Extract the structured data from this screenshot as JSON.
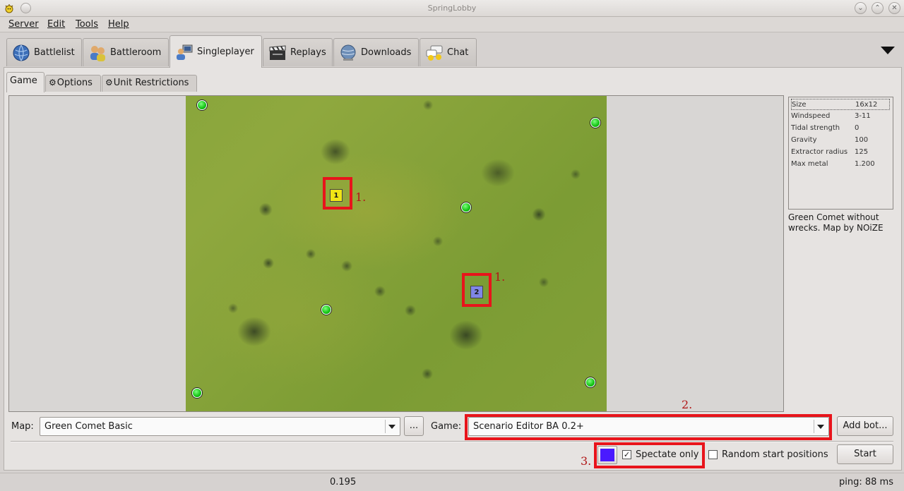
{
  "window": {
    "title": "SpringLobby"
  },
  "menubar": [
    {
      "label": "Server"
    },
    {
      "label": "Edit"
    },
    {
      "label": "Tools"
    },
    {
      "label": "Help"
    }
  ],
  "main_tabs": [
    {
      "label": "Battlelist",
      "icon": "globe-icon"
    },
    {
      "label": "Battleroom",
      "icon": "users-icon"
    },
    {
      "label": "Singleplayer",
      "icon": "user-computer-icon",
      "active": true
    },
    {
      "label": "Replays",
      "icon": "clapperboard-icon"
    },
    {
      "label": "Downloads",
      "icon": "globe-download-icon"
    },
    {
      "label": "Chat",
      "icon": "chat-icon"
    }
  ],
  "sub_tabs": [
    {
      "label": "Game",
      "active": true
    },
    {
      "label": "Options"
    },
    {
      "label": "Unit Restrictions"
    }
  ],
  "map_info": {
    "rows": [
      {
        "key": "Size",
        "value": "16x12"
      },
      {
        "key": "Windspeed",
        "value": "3-11"
      },
      {
        "key": "Tidal strength",
        "value": "0"
      },
      {
        "key": "Gravity",
        "value": "100"
      },
      {
        "key": "Extractor radius",
        "value": "125"
      },
      {
        "key": "Max metal",
        "value": "1.200"
      }
    ],
    "description": "Green Comet without wrecks. Map by NOiZE"
  },
  "markers": {
    "player1": "1",
    "player2": "2"
  },
  "annotations": {
    "one_a": "1.",
    "one_b": "1.",
    "two": "2.",
    "three": "3."
  },
  "controls": {
    "map_label": "Map:",
    "map_value": "Green Comet Basic",
    "browse_label": "...",
    "game_label": "Game:",
    "game_value": "Scenario Editor BA 0.2+",
    "add_bot_label": "Add bot...",
    "spectate_label": "Spectate only",
    "spectate_checked": true,
    "random_start_label": "Random start positions",
    "random_start_checked": false,
    "start_label": "Start",
    "player_color": "#4a1aff"
  },
  "status": {
    "version": "0.195",
    "ping": "ping: 88 ms"
  }
}
